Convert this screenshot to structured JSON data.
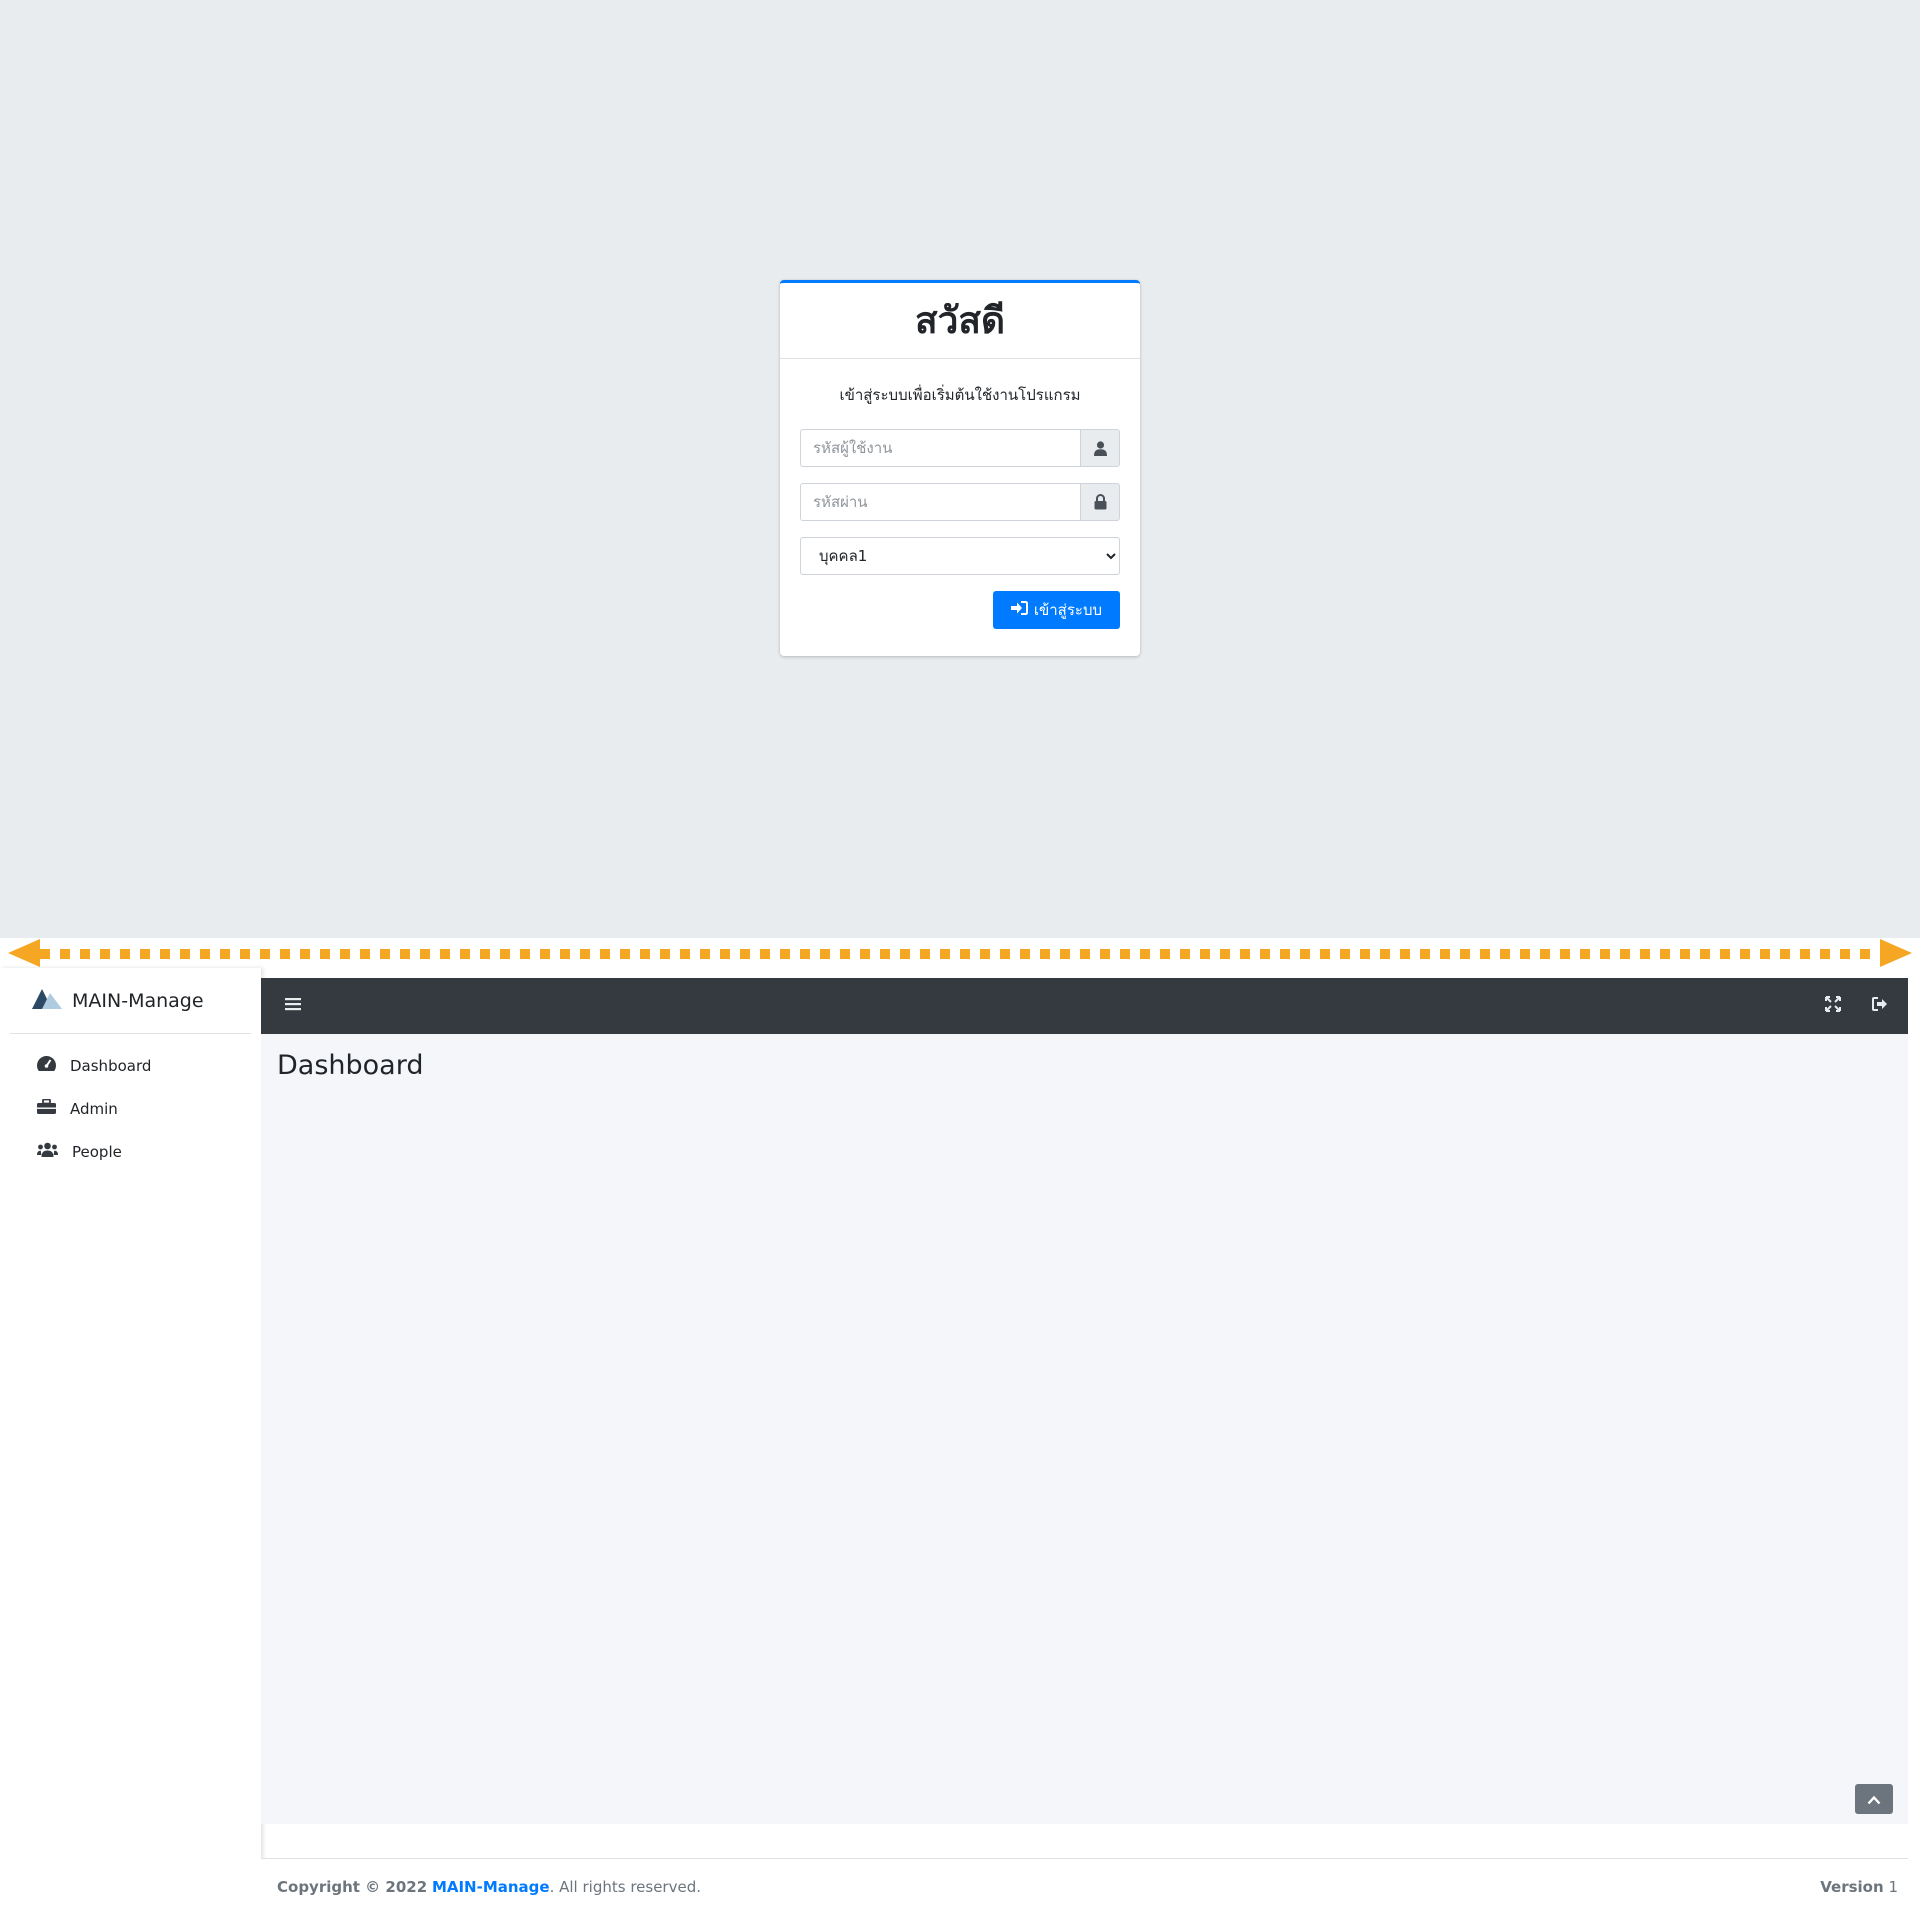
{
  "login": {
    "title": "สวัสดี",
    "message": "เข้าสู่ระบบเพื่อเริ่มต้นใช้งานโปรแกรม",
    "username_placeholder": "รหัสผู้ใช้งาน",
    "password_placeholder": "รหัสผ่าน",
    "role_selected": "บุคคล1",
    "role_options": [
      "บุคคล1"
    ],
    "submit_label": "เข้าสู่ระบบ",
    "accent_color": "#007bff"
  },
  "app": {
    "brand": "MAIN-Manage",
    "sidebar": {
      "items": [
        {
          "label": "Dashboard",
          "icon": "tachometer-icon"
        },
        {
          "label": "Admin",
          "icon": "toolbox-icon"
        },
        {
          "label": "People",
          "icon": "users-icon"
        }
      ]
    },
    "header": {
      "icons": [
        "menu-icon",
        "fullscreen-icon",
        "logout-icon"
      ],
      "bg_color": "#343a40"
    },
    "page_title": "Dashboard",
    "footer": {
      "copyright_prefix": "Copyright © 2022",
      "brand_link": "MAIN-Manage",
      "suffix": ". All rights reserved.",
      "version_label": "Version",
      "version_number": "1"
    }
  }
}
